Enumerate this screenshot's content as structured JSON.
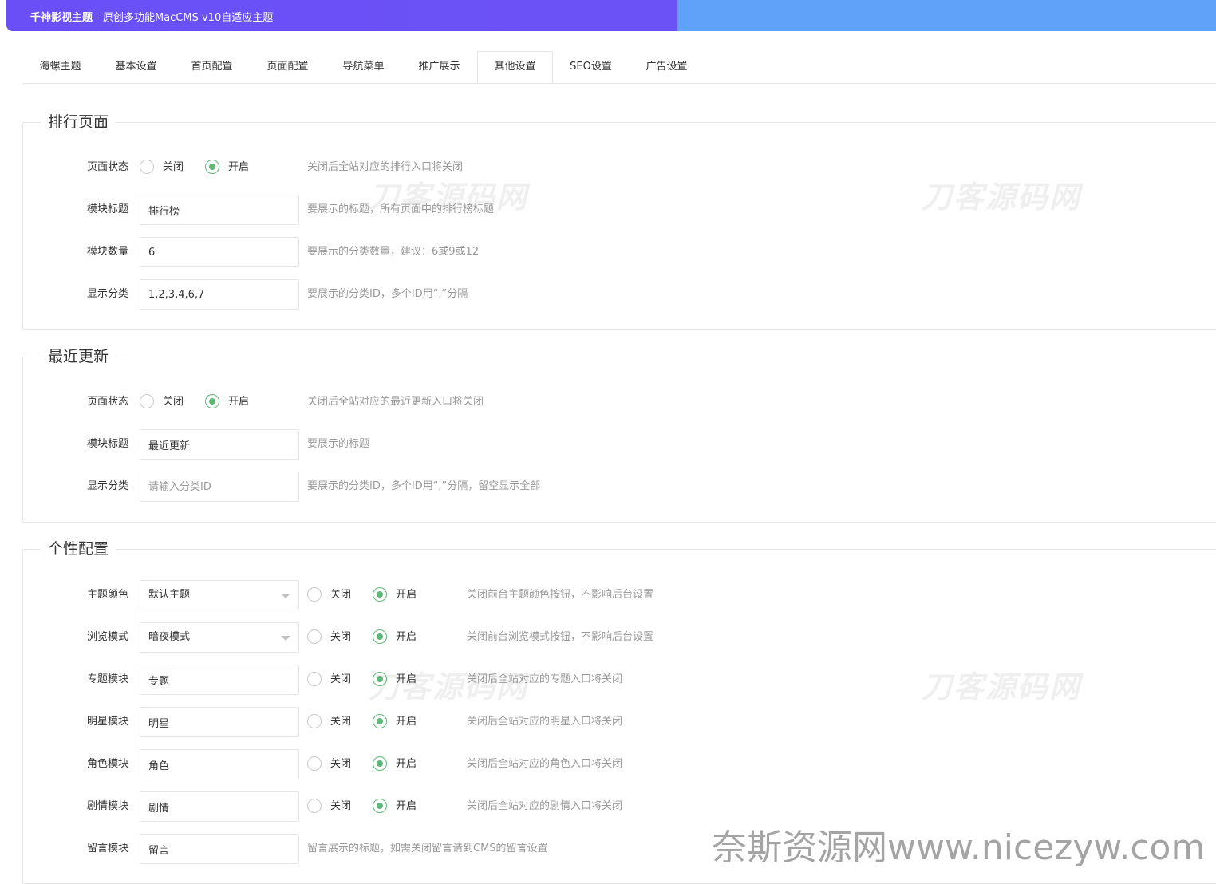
{
  "header": {
    "brand": "千神影视主题",
    "subtitle": " - 原创多功能MacCMS v10自适应主题"
  },
  "tabs": [
    {
      "label": "海螺主题"
    },
    {
      "label": "基本设置"
    },
    {
      "label": "首页配置"
    },
    {
      "label": "页面配置"
    },
    {
      "label": "导航菜单"
    },
    {
      "label": "推广展示"
    },
    {
      "label": "其他设置",
      "active": true
    },
    {
      "label": "SEO设置"
    },
    {
      "label": "广告设置"
    }
  ],
  "ranking": {
    "title": "排行页面",
    "status": {
      "label": "页面状态",
      "off": "关闭",
      "on": "开启",
      "selected": "on",
      "hint": "关闭后全站对应的排行入口将关闭"
    },
    "module_title": {
      "label": "模块标题",
      "value": "排行榜",
      "hint": "要展示的标题，所有页面中的排行榜标题"
    },
    "module_count": {
      "label": "模块数量",
      "value": "6",
      "hint": "要展示的分类数量，建议：6或9或12"
    },
    "categories": {
      "label": "显示分类",
      "value": "1,2,3,4,6,7",
      "hint": "要展示的分类ID，多个ID用“,”分隔"
    }
  },
  "recent": {
    "title": "最近更新",
    "status": {
      "label": "页面状态",
      "off": "关闭",
      "on": "开启",
      "selected": "on",
      "hint": "关闭后全站对应的最近更新入口将关闭"
    },
    "module_title": {
      "label": "模块标题",
      "value": "最近更新",
      "hint": "要展示的标题"
    },
    "categories": {
      "label": "显示分类",
      "value": "",
      "placeholder": "请输入分类ID",
      "hint": "要展示的分类ID，多个ID用“,”分隔，留空显示全部"
    }
  },
  "personal": {
    "title": "个性配置",
    "theme_color": {
      "label": "主题颜色",
      "value": "默认主题",
      "off": "关闭",
      "on": "开启",
      "selected": "on",
      "hint": "关闭前台主题颜色按钮，不影响后台设置"
    },
    "browse_mode": {
      "label": "浏览模式",
      "value": "暗夜模式",
      "off": "关闭",
      "on": "开启",
      "selected": "on",
      "hint": "关闭前台浏览模式按钮，不影响后台设置"
    },
    "topic": {
      "label": "专题模块",
      "value": "专题",
      "off": "关闭",
      "on": "开启",
      "selected": "on",
      "hint": "关闭后全站对应的专题入口将关闭"
    },
    "star": {
      "label": "明星模块",
      "value": "明星",
      "off": "关闭",
      "on": "开启",
      "selected": "on",
      "hint": "关闭后全站对应的明星入口将关闭"
    },
    "role": {
      "label": "角色模块",
      "value": "角色",
      "off": "关闭",
      "on": "开启",
      "selected": "on",
      "hint": "关闭后全站对应的角色入口将关闭"
    },
    "plot": {
      "label": "剧情模块",
      "value": "剧情",
      "off": "关闭",
      "on": "开启",
      "selected": "on",
      "hint": "关闭后全站对应的剧情入口将关闭"
    },
    "message": {
      "label": "留言模块",
      "value": "留言",
      "hint": "留言展示的标题，如需关闭留言请到CMS的留言设置"
    }
  },
  "watermarks": {
    "logo": "刀客源码网",
    "site": "奈斯资源网www.nicezyw.com"
  },
  "colors": {
    "accent": "#5fb878",
    "banner_left": "#6a4ff7",
    "banner_right": "#60a2fa"
  }
}
